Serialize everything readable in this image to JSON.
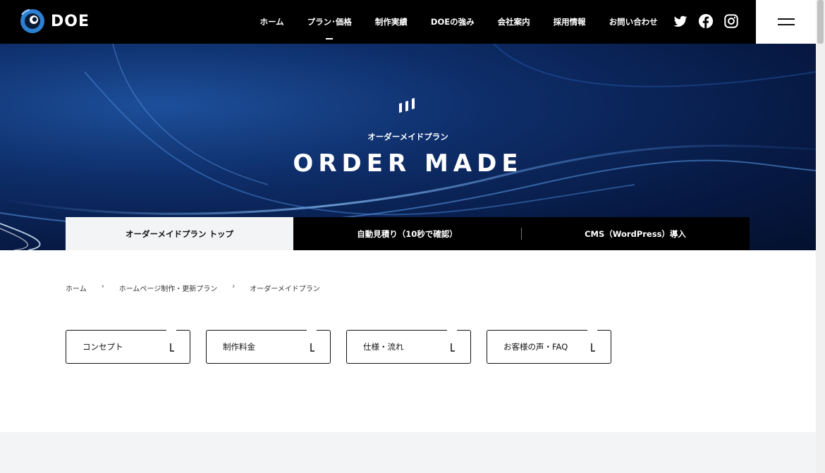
{
  "header": {
    "logo_text": "DOE",
    "nav": [
      {
        "label": "ホーム"
      },
      {
        "label": "プラン･価格"
      },
      {
        "label": "制作実績"
      },
      {
        "label": "DOEの強み"
      },
      {
        "label": "会社案内"
      },
      {
        "label": "採用情報"
      },
      {
        "label": "お問い合わせ"
      }
    ],
    "active_nav": "プラン･価格",
    "social_icons": [
      "twitter-icon",
      "facebook-icon",
      "instagram-icon"
    ],
    "menu_icon": "hamburger-menu-icon"
  },
  "hero": {
    "subtitle": "オーダーメイドプラン",
    "title": "ORDER MADE",
    "accent_color": "#0e2e6a"
  },
  "tabs": [
    {
      "label": "オーダーメイドプラン トップ",
      "current": true
    },
    {
      "label": "自動見積り（10秒で確認）",
      "current": false
    },
    {
      "label": "CMS（WordPress）導入",
      "current": false
    }
  ],
  "breadcrumb": {
    "items": [
      "ホーム",
      "ホームページ制作・更新プラン",
      "オーダーメイドプラン"
    ],
    "separator": "›"
  },
  "anchors": [
    {
      "label": "コンセプト"
    },
    {
      "label": "制作料金"
    },
    {
      "label": "仕様・流れ"
    },
    {
      "label": "お客様の声・FAQ"
    }
  ]
}
